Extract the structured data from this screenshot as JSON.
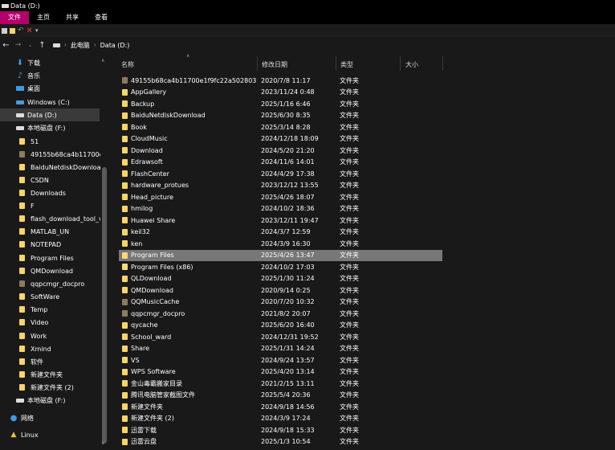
{
  "window": {
    "title": "Data (D:)"
  },
  "ribbon": {
    "tabs": [
      "文件",
      "主页",
      "共享",
      "查看"
    ]
  },
  "address": {
    "path": [
      "此电脑",
      "Data (D:)"
    ]
  },
  "sidebar": {
    "items": [
      {
        "label": "下载",
        "icon": "download-icon"
      },
      {
        "label": "音乐",
        "icon": "music-icon"
      },
      {
        "label": "桌面",
        "icon": "desktop-icon"
      },
      {
        "label": "Windows (C:)",
        "icon": "drive-icon"
      },
      {
        "label": "Data (D:)",
        "icon": "drive-icon"
      },
      {
        "label": "本地磁盘 (F:)",
        "icon": "drive-icon"
      },
      {
        "label": "51",
        "icon": "folder-icon"
      },
      {
        "label": "49155b68ca4b11700e",
        "icon": "folder-icon"
      },
      {
        "label": "BaiduNetdiskDownload",
        "icon": "folder-icon"
      },
      {
        "label": "CSDN",
        "icon": "folder-icon"
      },
      {
        "label": "Downloads",
        "icon": "folder-icon"
      },
      {
        "label": "F",
        "icon": "folder-icon"
      },
      {
        "label": "flash_download_tool_v",
        "icon": "folder-icon"
      },
      {
        "label": "MATLAB_UN",
        "icon": "folder-icon"
      },
      {
        "label": "NOTEPAD",
        "icon": "folder-icon"
      },
      {
        "label": "Program Files",
        "icon": "folder-icon"
      },
      {
        "label": "QMDownload",
        "icon": "folder-icon"
      },
      {
        "label": "qqpcmgr_docpro",
        "icon": "folder-icon"
      },
      {
        "label": "SoftWare",
        "icon": "folder-icon"
      },
      {
        "label": "Temp",
        "icon": "folder-icon"
      },
      {
        "label": "Video",
        "icon": "folder-icon"
      },
      {
        "label": "Work",
        "icon": "folder-icon"
      },
      {
        "label": "Xmind",
        "icon": "folder-icon"
      },
      {
        "label": "软件",
        "icon": "folder-icon"
      },
      {
        "label": "新建文件夹",
        "icon": "folder-icon"
      },
      {
        "label": "新建文件夹 (2)",
        "icon": "folder-icon"
      },
      {
        "label": "本地磁盘 (F:)",
        "icon": "drive-icon"
      },
      {
        "label": "网络",
        "icon": "network-icon"
      },
      {
        "label": "Linux",
        "icon": "linux-icon"
      }
    ]
  },
  "columns": {
    "name": "名称",
    "date": "修改日期",
    "type": "类型",
    "size": "大小"
  },
  "files": [
    {
      "name": "49155b68ca4b11700e1f9fc22a502803",
      "date": "2020/7/8 11:17",
      "type": "文件夹"
    },
    {
      "name": "AppGallery",
      "date": "2023/11/24 0:48",
      "type": "文件夹"
    },
    {
      "name": "Backup",
      "date": "2025/1/16 6:46",
      "type": "文件夹"
    },
    {
      "name": "BaiduNetdiskDownload",
      "date": "2025/6/30 8:35",
      "type": "文件夹"
    },
    {
      "name": "Book",
      "date": "2025/3/14 8:28",
      "type": "文件夹"
    },
    {
      "name": "CloudMusic",
      "date": "2024/12/18 18:09",
      "type": "文件夹"
    },
    {
      "name": "Download",
      "date": "2024/5/20 21:20",
      "type": "文件夹"
    },
    {
      "name": "Edrawsoft",
      "date": "2024/11/6 14:01",
      "type": "文件夹"
    },
    {
      "name": "FlashCenter",
      "date": "2024/4/29 17:38",
      "type": "文件夹"
    },
    {
      "name": "hardware_protues",
      "date": "2023/12/12 13:55",
      "type": "文件夹"
    },
    {
      "name": "Head_picture",
      "date": "2025/4/26 18:07",
      "type": "文件夹"
    },
    {
      "name": "hmilog",
      "date": "2024/10/2 18:36",
      "type": "文件夹"
    },
    {
      "name": "Huawei Share",
      "date": "2023/12/11 19:47",
      "type": "文件夹"
    },
    {
      "name": "keil32",
      "date": "2024/3/7 12:59",
      "type": "文件夹"
    },
    {
      "name": "ken",
      "date": "2024/3/9 16:30",
      "type": "文件夹"
    },
    {
      "name": "Program Files",
      "date": "2025/4/26 13:47",
      "type": "文件夹"
    },
    {
      "name": "Program Files (x86)",
      "date": "2024/10/2 17:03",
      "type": "文件夹"
    },
    {
      "name": "QLDownload",
      "date": "2025/1/30 11:24",
      "type": "文件夹"
    },
    {
      "name": "QMDownload",
      "date": "2020/9/14 0:25",
      "type": "文件夹"
    },
    {
      "name": "QQMusicCache",
      "date": "2020/7/20 10:32",
      "type": "文件夹"
    },
    {
      "name": "qqpcmgr_docpro",
      "date": "2021/8/2 20:07",
      "type": "文件夹"
    },
    {
      "name": "qycache",
      "date": "2025/6/20 16:40",
      "type": "文件夹"
    },
    {
      "name": "School_ward",
      "date": "2024/12/31 19:52",
      "type": "文件夹"
    },
    {
      "name": "Share",
      "date": "2025/1/31 14:24",
      "type": "文件夹"
    },
    {
      "name": "VS",
      "date": "2024/9/24 13:57",
      "type": "文件夹"
    },
    {
      "name": "WPS Software",
      "date": "2025/4/20 13:14",
      "type": "文件夹"
    },
    {
      "name": "金山毒霸搬家目录",
      "date": "2021/2/15 13:11",
      "type": "文件夹"
    },
    {
      "name": "腾讯电脑管家截图文件",
      "date": "2025/5/4 20:36",
      "type": "文件夹"
    },
    {
      "name": "新建文件夹",
      "date": "2024/9/18 14:56",
      "type": "文件夹"
    },
    {
      "name": "新建文件夹 (2)",
      "date": "2024/3/9 17:24",
      "type": "文件夹"
    },
    {
      "name": "迅雷下载",
      "date": "2024/9/18 15:33",
      "type": "文件夹"
    },
    {
      "name": "迅雷云盘",
      "date": "2025/1/3 10:54",
      "type": "文件夹"
    }
  ],
  "colors": {
    "accent_tab": "#b4006c",
    "folder": "#f8d568",
    "selected_row": "#777777"
  }
}
